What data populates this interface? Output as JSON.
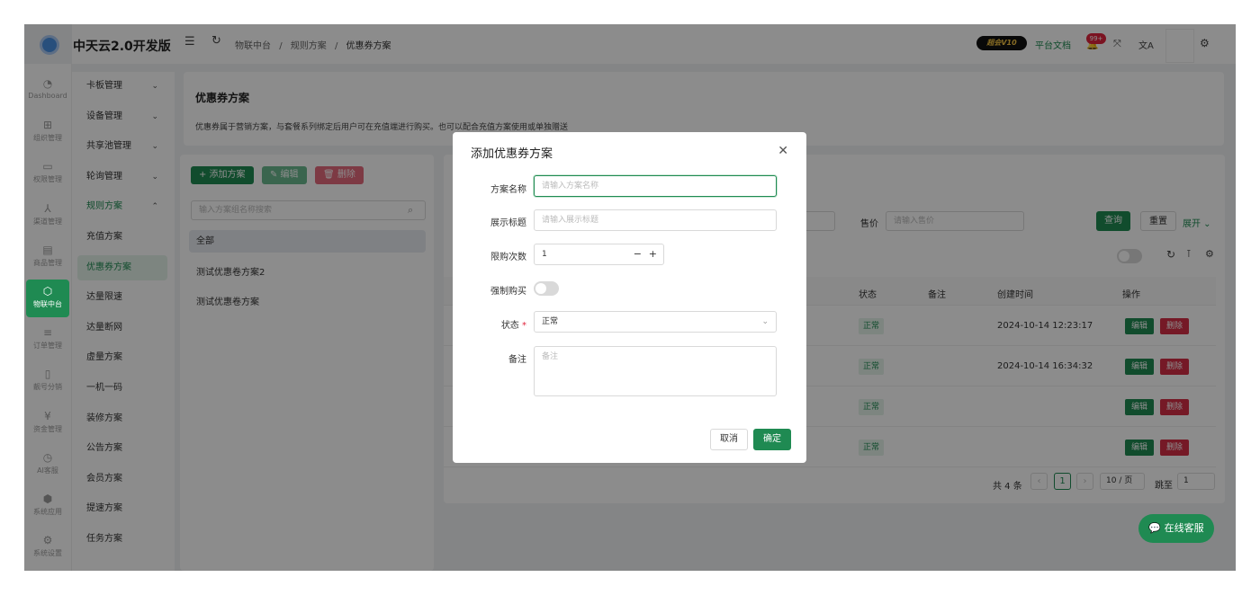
{
  "app": {
    "brand": "中天云2.0开发版"
  },
  "rail": [
    {
      "icon": "◔",
      "label": "Dashboard",
      "name": "rail-dashboard"
    },
    {
      "icon": "⊞",
      "label": "组织管理",
      "name": "rail-org"
    },
    {
      "icon": "▭",
      "label": "权限管理",
      "name": "rail-permission"
    },
    {
      "icon": "⅄",
      "label": "渠道管理",
      "name": "rail-channel"
    },
    {
      "icon": "▤",
      "label": "商品管理",
      "name": "rail-goods"
    },
    {
      "icon": "⬡",
      "label": "物联中台",
      "name": "rail-iot"
    },
    {
      "icon": "≡",
      "label": "订单管理",
      "name": "rail-order"
    },
    {
      "icon": "▯",
      "label": "靓号分销",
      "name": "rail-number"
    },
    {
      "icon": "¥",
      "label": "资金管理",
      "name": "rail-fund"
    },
    {
      "icon": "◷",
      "label": "AI客服",
      "name": "rail-ai"
    },
    {
      "icon": "⬢",
      "label": "系统应用",
      "name": "rail-apps"
    },
    {
      "icon": "⚙",
      "label": "系统设置",
      "name": "rail-settings"
    }
  ],
  "submenu": [
    {
      "label": "卡板管理",
      "chev": "⌄"
    },
    {
      "label": "设备管理",
      "chev": "⌄"
    },
    {
      "label": "共享池管理",
      "chev": "⌄"
    },
    {
      "label": "轮询管理",
      "chev": "⌄"
    },
    {
      "label": "规则方案",
      "chev": "⌃"
    },
    {
      "label": "充值方案",
      "chev": ""
    },
    {
      "label": "优惠券方案",
      "chev": ""
    },
    {
      "label": "达量限速",
      "chev": ""
    },
    {
      "label": "达量断网",
      "chev": ""
    },
    {
      "label": "虚量方案",
      "chev": ""
    },
    {
      "label": "一机一码",
      "chev": ""
    },
    {
      "label": "装修方案",
      "chev": ""
    },
    {
      "label": "公告方案",
      "chev": ""
    },
    {
      "label": "会员方案",
      "chev": ""
    },
    {
      "label": "提速方案",
      "chev": ""
    },
    {
      "label": "任务方案",
      "chev": ""
    }
  ],
  "breadcrumb": {
    "a": "物联中台",
    "sep": "/",
    "b": "规则方案",
    "c": "优惠券方案"
  },
  "header": {
    "badge": "超会V10",
    "docs": "平台文档",
    "notif": "99+"
  },
  "page": {
    "title": "优惠券方案",
    "desc": "优惠券属于营销方案，与套餐系列绑定后用户可在充值端进行购买。也可以配合充值方案使用或单独赠送"
  },
  "toolbar": {
    "add": "+ 添加方案",
    "edit": "✎ 编辑",
    "del": "🗑 删除"
  },
  "left_list": {
    "search_placeholder": "输入方案组名称搜索",
    "items": [
      "全部",
      "测试优惠卷方案2",
      "测试优惠卷方案"
    ]
  },
  "filters": {
    "price_label": "售价",
    "price_placeholder": "请输入售价",
    "query": "查询",
    "reset": "重置",
    "expand": "展开 ⌄"
  },
  "table": {
    "headers": {
      "status": "状态",
      "remark": "备注",
      "created": "创建时间",
      "ops": "操作"
    },
    "rows": [
      {
        "status": "正常",
        "created": "2024-10-14 12:23:17",
        "edit": "编辑",
        "del": "删除"
      },
      {
        "status": "正常",
        "created": "2024-10-14 16:34:32",
        "edit": "编辑",
        "del": "删除"
      },
      {
        "status": "正常",
        "created": "",
        "edit": "编辑",
        "del": "删除"
      },
      {
        "status": "正常",
        "created": "",
        "edit": "编辑",
        "del": "删除"
      }
    ]
  },
  "pagination": {
    "total": "共 4 条",
    "page": "1",
    "size": "10 / 页",
    "jump_label": "跳至",
    "jump_value": "1"
  },
  "modal": {
    "title": "添加优惠券方案",
    "fields": {
      "name_label": "方案名称",
      "name_placeholder": "请输入方案名称",
      "display_label": "展示标题",
      "display_placeholder": "请输入展示标题",
      "limit_label": "限购次数",
      "limit_value": "1",
      "force_label": "强制购买",
      "status_label": "状态",
      "status_value": "正常",
      "remark_label": "备注",
      "remark_placeholder": "备注"
    },
    "cancel": "取消",
    "ok": "确定"
  },
  "chat": "在线客服"
}
